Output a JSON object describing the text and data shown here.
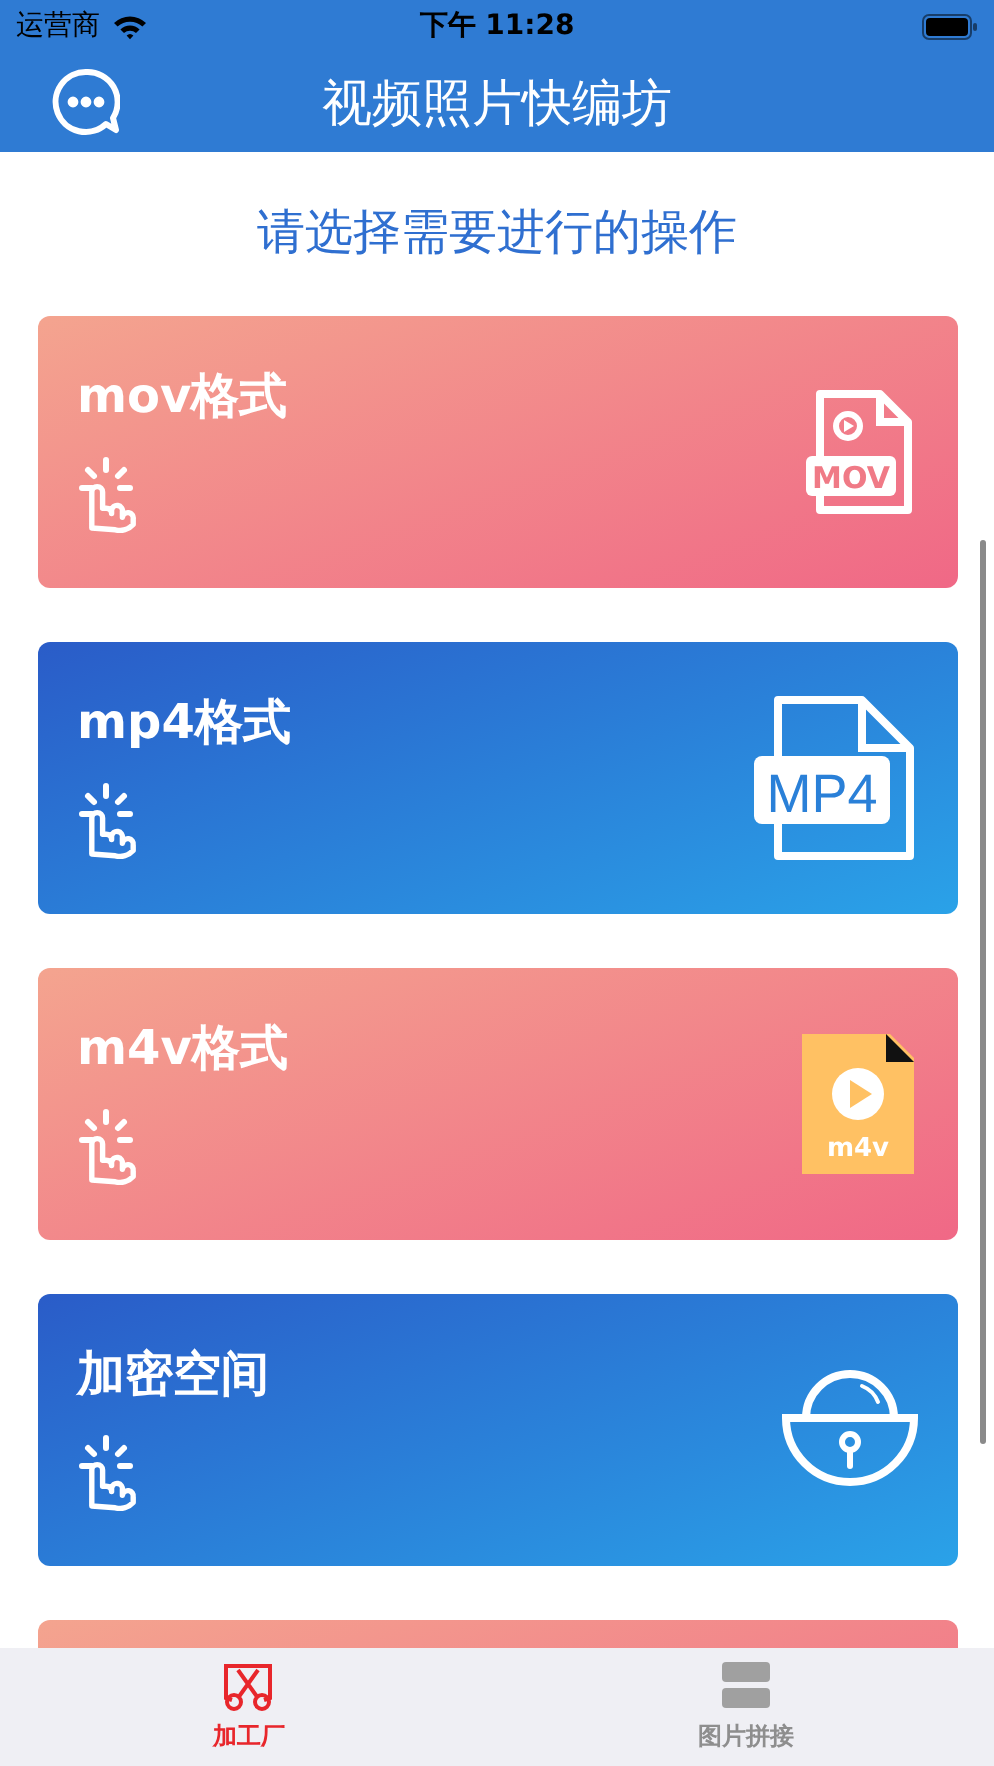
{
  "status_bar": {
    "carrier": "运营商",
    "time": "下午 11:28"
  },
  "nav": {
    "title": "视频照片快编坊"
  },
  "heading": "请选择需要进行的操作",
  "cards": [
    {
      "kind": "pink",
      "title": "mov格式",
      "icon_label": "MOV"
    },
    {
      "kind": "blue",
      "title": "mp4格式",
      "icon_label": "MP4"
    },
    {
      "kind": "pink",
      "title": "m4v格式",
      "icon_label": "m4v"
    },
    {
      "kind": "blue",
      "title": "加密空间"
    },
    {
      "kind": "pink"
    }
  ],
  "tabs": [
    {
      "label": "加工厂",
      "selected": true
    },
    {
      "label": "图片拼接",
      "selected": false
    }
  ]
}
